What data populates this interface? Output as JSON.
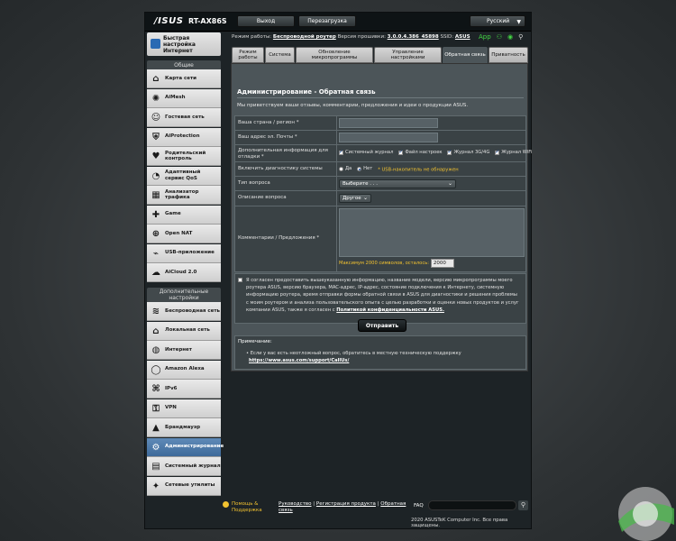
{
  "header": {
    "logo": "/ISUS",
    "model": "RT-AX86S",
    "logout": "Выход",
    "reboot": "Перезагрузка",
    "language": "Русский"
  },
  "sidebar": {
    "qis": "Быстрая настройка Интернет",
    "general_header": "Общие",
    "general_items": [
      {
        "label": "Карта сети",
        "icon": "network-map-icon"
      },
      {
        "label": "AiMesh",
        "icon": "aimesh-icon"
      },
      {
        "label": "Гостевая сеть",
        "icon": "guest-network-icon"
      },
      {
        "label": "AiProtection",
        "icon": "aiprotection-icon"
      },
      {
        "label": "Родительский контроль",
        "icon": "parental-control-icon"
      },
      {
        "label": "Адаптивный сервис QoS",
        "icon": "qos-icon"
      },
      {
        "label": "Анализатор трафика",
        "icon": "traffic-analyzer-icon"
      },
      {
        "label": "Game",
        "icon": "game-icon"
      },
      {
        "label": "Open NAT",
        "icon": "open-nat-icon"
      },
      {
        "label": "USB-приложение",
        "icon": "usb-icon"
      },
      {
        "label": "AiCloud 2.0",
        "icon": "aicloud-icon"
      }
    ],
    "advanced_header": "Дополнительные настройки",
    "advanced_items": [
      {
        "label": "Беспроводная сеть",
        "icon": "wireless-icon"
      },
      {
        "label": "Локальная сеть",
        "icon": "lan-icon"
      },
      {
        "label": "Интернет",
        "icon": "wan-icon"
      },
      {
        "label": "Amazon Alexa",
        "icon": "alexa-icon"
      },
      {
        "label": "IPv6",
        "icon": "ipv6-icon"
      },
      {
        "label": "VPN",
        "icon": "vpn-icon"
      },
      {
        "label": "Брандмауэр",
        "icon": "firewall-icon"
      },
      {
        "label": "Администрирование",
        "icon": "administration-icon"
      },
      {
        "label": "Системный журнал",
        "icon": "system-log-icon"
      },
      {
        "label": "Сетевые утилиты",
        "icon": "network-tools-icon"
      }
    ]
  },
  "status": {
    "mode_label": "Режим работы:",
    "mode_value": "Беспроводной роутер",
    "fw_label": "Версия прошивки:",
    "fw_value": "3.0.0.4.386_45898",
    "ssid_label": "SSID:",
    "ssid_value": "ASUS",
    "app_label": "App"
  },
  "tabs": [
    "Режим работы",
    "Система",
    "Обновление микропрограммы",
    "Управление настройками",
    "Обратная связь",
    "Приватность"
  ],
  "page": {
    "title": "Администрирование - Обратная связь",
    "intro": "Мы приветствуем ваши отзывы, комментарии, предложения и идеи о продукции ASUS."
  },
  "form": {
    "country_label": "Ваша страна / регион *",
    "email_label": "Ваш адрес эл. Почты *",
    "extra_label": "Дополнительная информация для отладки *",
    "checks": [
      "Системный журнал",
      "Файл настроек",
      "Журнал 3G/4G",
      "Журнал WiFi"
    ],
    "diag_label": "Включить диагностику системы",
    "radio_yes": "Да",
    "radio_no": "Нет",
    "usb_warn": "* USB-накопитель не обнаружен",
    "type_label": "Тип вопроса",
    "type_value": "Выберите . . .",
    "desc_label": "Описание вопроса",
    "desc_value": "Другое",
    "comments_label": "Комментарии / Предложения *",
    "maxlen": "Максимум 2000 символов, осталось:",
    "remaining": "2000"
  },
  "consent": {
    "text": "Я согласен предоставить вышеуказанную информацию, название модели, версию микропрограммы моего роутера ASUS, версию браузера, MAC-адрес, IP-адрес, состояние подключения к Интернету, системную информацию роутера, время отправки формы обратной связи в ASUS для диагностики и решения проблемы с моим роутером и анализа пользовательского опыта с целью разработки и оценки новых продуктов и услуг компании ASUS, также я согласен с",
    "link": "Политикой конфиденциальности ASUS.",
    "send": "Отправить"
  },
  "notes": {
    "header": "Примечание:",
    "body": "• Если у вас есть неотложный вопрос, обратитесь в местную техническую поддержку",
    "link": "https://www.asus.com/support/CallUs/"
  },
  "footer": {
    "help1": "Помощь &",
    "help2": "Поддержка",
    "manual": "Руководство",
    "registration": "Регистрация продукта",
    "feedback": "Обратная",
    "feedback2": "связь",
    "faq": "FAQ",
    "copyright": "2020 ASUSTeK Computer Inc. Все права защищены."
  }
}
